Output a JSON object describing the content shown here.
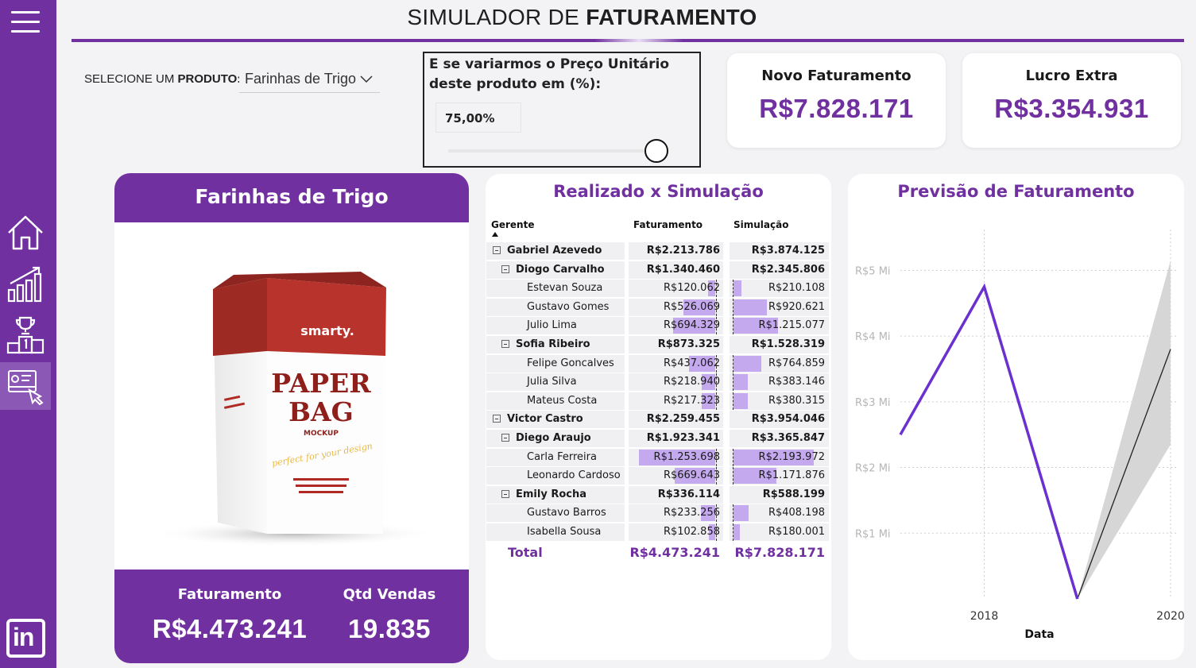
{
  "header": {
    "title_prefix": "SIMULADOR DE ",
    "title_bold": "FATURAMENTO"
  },
  "selector": {
    "label_prefix": "SELECIONE UM ",
    "label_bold": "PRODUTO:",
    "value": "Farinhas de Trigo"
  },
  "whatif": {
    "question": "E se variarmos o Preço Unitário deste produto em (%):",
    "value": "75,00%",
    "level": 0.8
  },
  "kpis": [
    {
      "label": "Novo Faturamento",
      "value": "R$7.828.171"
    },
    {
      "label": "Lucro Extra",
      "value": "R$3.354.931"
    }
  ],
  "product_card": {
    "title": "Farinhas de Trigo",
    "image_texts": {
      "brand": "smarty.",
      "line1": "PAPER",
      "line2": "BAG",
      "line3": "MOCKUP",
      "script": "perfect for your design"
    },
    "faturamento_label": "Faturamento",
    "faturamento_value": "R$4.473.241",
    "qtd_label": "Qtd Vendas",
    "qtd_value": "19.835"
  },
  "table": {
    "title": "Realizado x Simulação",
    "headers": {
      "gerente": "Gerente",
      "faturamento": "Faturamento",
      "simulacao": "Simulação"
    },
    "rows": [
      {
        "name": "Gabriel Azevedo",
        "level": 0,
        "bold": true,
        "toggle": true,
        "fat": "R$2.213.786",
        "sim": "R$3.874.125"
      },
      {
        "name": "Diogo Carvalho",
        "level": 1,
        "bold": true,
        "toggle": true,
        "fat": "R$1.340.460",
        "sim": "R$2.345.806"
      },
      {
        "name": "Estevan Souza",
        "level": 2,
        "bold": false,
        "toggle": false,
        "fat": "R$120.062",
        "sim": "R$210.108",
        "fat_v": 120062,
        "sim_v": 210108
      },
      {
        "name": "Gustavo Gomes",
        "level": 2,
        "bold": false,
        "toggle": false,
        "fat": "R$526.069",
        "sim": "R$920.621",
        "fat_v": 526069,
        "sim_v": 920621
      },
      {
        "name": "Julio Lima",
        "level": 2,
        "bold": false,
        "toggle": false,
        "fat": "R$694.329",
        "sim": "R$1.215.077",
        "fat_v": 694329,
        "sim_v": 1215077
      },
      {
        "name": "Sofia Ribeiro",
        "level": 1,
        "bold": true,
        "toggle": true,
        "fat": "R$873.325",
        "sim": "R$1.528.319"
      },
      {
        "name": "Felipe Goncalves",
        "level": 2,
        "bold": false,
        "toggle": false,
        "fat": "R$437.062",
        "sim": "R$764.859",
        "fat_v": 437062,
        "sim_v": 764859
      },
      {
        "name": "Julia Silva",
        "level": 2,
        "bold": false,
        "toggle": false,
        "fat": "R$218.940",
        "sim": "R$383.146",
        "fat_v": 218940,
        "sim_v": 383146
      },
      {
        "name": "Mateus Costa",
        "level": 2,
        "bold": false,
        "toggle": false,
        "fat": "R$217.323",
        "sim": "R$380.315",
        "fat_v": 217323,
        "sim_v": 380315
      },
      {
        "name": "Victor Castro",
        "level": 0,
        "bold": true,
        "toggle": true,
        "fat": "R$2.259.455",
        "sim": "R$3.954.046"
      },
      {
        "name": "Diego Araujo",
        "level": 1,
        "bold": true,
        "toggle": true,
        "fat": "R$1.923.341",
        "sim": "R$3.365.847"
      },
      {
        "name": "Carla Ferreira",
        "level": 2,
        "bold": false,
        "toggle": false,
        "fat": "R$1.253.698",
        "sim": "R$2.193.972",
        "fat_v": 1253698,
        "sim_v": 2193972
      },
      {
        "name": "Leonardo Cardoso",
        "level": 2,
        "bold": false,
        "toggle": false,
        "fat": "R$669.643",
        "sim": "R$1.171.876",
        "fat_v": 669643,
        "sim_v": 1171876
      },
      {
        "name": "Emily Rocha",
        "level": 1,
        "bold": true,
        "toggle": true,
        "fat": "R$336.114",
        "sim": "R$588.199"
      },
      {
        "name": "Gustavo Barros",
        "level": 2,
        "bold": false,
        "toggle": false,
        "fat": "R$233.256",
        "sim": "R$408.198",
        "fat_v": 233256,
        "sim_v": 408198
      },
      {
        "name": "Isabella Sousa",
        "level": 2,
        "bold": false,
        "toggle": false,
        "fat": "R$102.858",
        "sim": "R$180.001",
        "fat_v": 102858,
        "sim_v": 180001
      }
    ],
    "total": {
      "label": "Total",
      "fat": "R$4.473.241",
      "sim": "R$7.828.171"
    }
  },
  "chart_data": {
    "type": "line",
    "title": "Previsão de Faturamento",
    "xlabel": "Data",
    "ylabel": "",
    "ylim": [
      0,
      5500000
    ],
    "xlim": [
      2017.1,
      2020.0
    ],
    "y_ticks": [
      1000000,
      2000000,
      3000000,
      4000000,
      5000000
    ],
    "y_tick_labels": [
      "R$1 Mi",
      "R$2 Mi",
      "R$3 Mi",
      "R$4 Mi",
      "R$5 Mi"
    ],
    "x_ticks": [
      2018,
      2020
    ],
    "x_tick_labels": [
      "2018",
      "2020"
    ],
    "grid": true,
    "series": [
      {
        "x": [
          2017.1,
          2018.0,
          2019.0
        ],
        "y": [
          2500000,
          4750000,
          0
        ]
      }
    ],
    "forecast": {
      "x": [
        2019.0,
        2020.0
      ],
      "y": [
        0,
        3800000
      ],
      "upper": [
        0,
        5150000
      ],
      "lower": [
        0,
        2350000
      ]
    },
    "colors": {
      "line": "#6a30d0",
      "forecast": "#222222",
      "band": "#d6d6d6"
    }
  },
  "colors": {
    "accent": "#7030a0",
    "bar": "#c5a9ef"
  }
}
